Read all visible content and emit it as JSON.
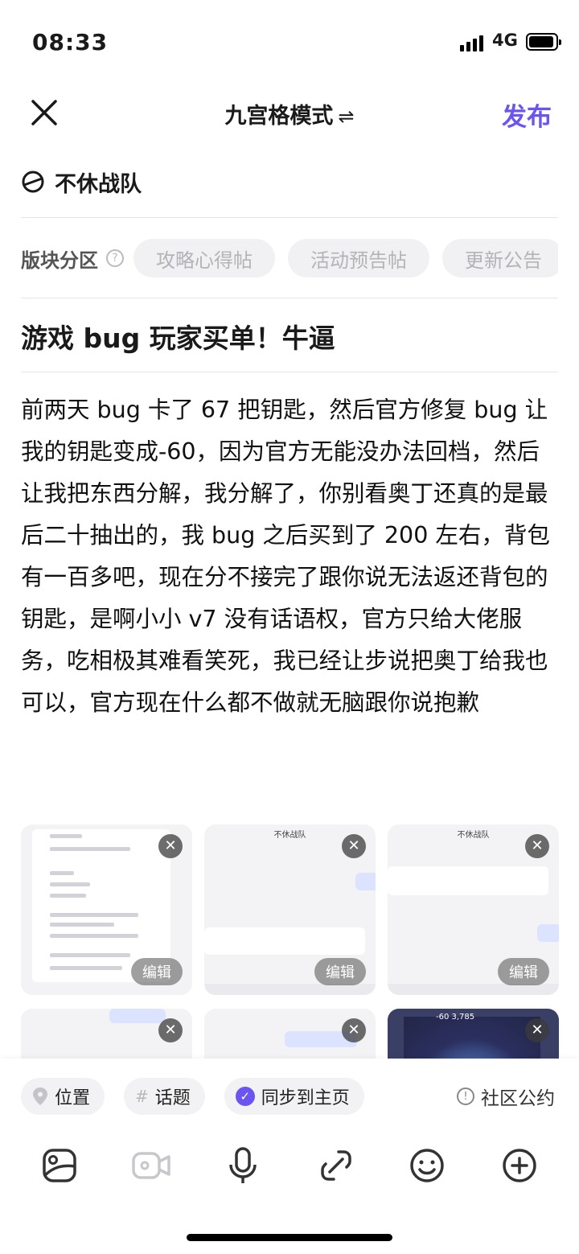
{
  "status_bar": {
    "time": "08:33",
    "network": "4G"
  },
  "header": {
    "title": "九宫格模式",
    "swap_symbol": "⇌",
    "publish_label": "发布"
  },
  "team": {
    "name": "不休战队"
  },
  "sections": {
    "label": "版块分区",
    "help": "?",
    "chips": [
      "攻略心得帖",
      "活动预告帖",
      "更新公告"
    ]
  },
  "post": {
    "title": "游戏 bug 玩家买单！牛逼",
    "body": "前两天 bug 卡了 67 把钥匙，然后官方修复 bug 让我的钥匙变成-60，因为官方无能没办法回档，然后让我把东西分解，我分解了，你别看奥丁还真的是最后二十抽出的，我 bug 之后买到了 200 左右，背包有一百多吧，现在分不接完了跟你说无法返还背包的钥匙，是啊小小 v7 没有话语权，官方只给大佬服务，吃相极其难看笑死，我已经让步说把奥丁给我也可以，官方现在什么都不做就无脑跟你说抱歉"
  },
  "images": {
    "remove_symbol": "✕",
    "edit_label": "编辑",
    "chat_header": "不休战队",
    "game_stats": "-60   3,785"
  },
  "options": {
    "location": "位置",
    "topic": "话题",
    "sync": "同步到主页",
    "rules": "社区公约"
  },
  "toolbar_icons": [
    "image-icon",
    "video-icon",
    "microphone-icon",
    "link-icon",
    "emoji-icon",
    "add-icon"
  ],
  "colors": {
    "accent": "#6a55f0"
  }
}
